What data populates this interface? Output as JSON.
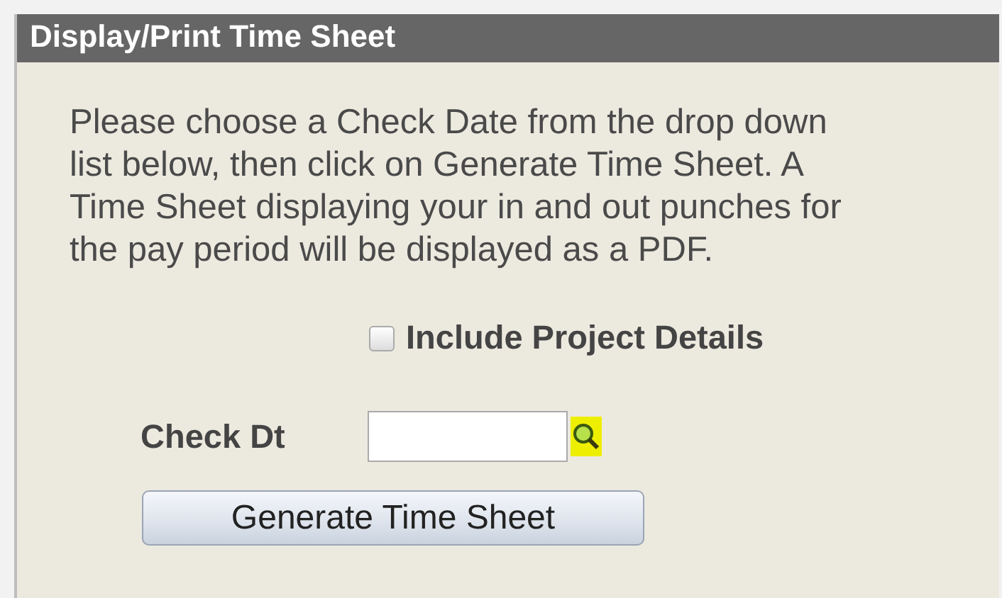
{
  "panel": {
    "title": "Display/Print Time Sheet"
  },
  "instructions": "Please choose a Check Date from the drop down list below, then click on Generate Time Sheet. A Time Sheet displaying your in and out punches for the pay period will be displayed as a PDF.",
  "include_project_details": {
    "label": "Include Project Details",
    "checked": false
  },
  "check_dt": {
    "label": "Check Dt"
  },
  "buttons": [
    {
      "label": "Generate Time Sheet"
    }
  ]
}
